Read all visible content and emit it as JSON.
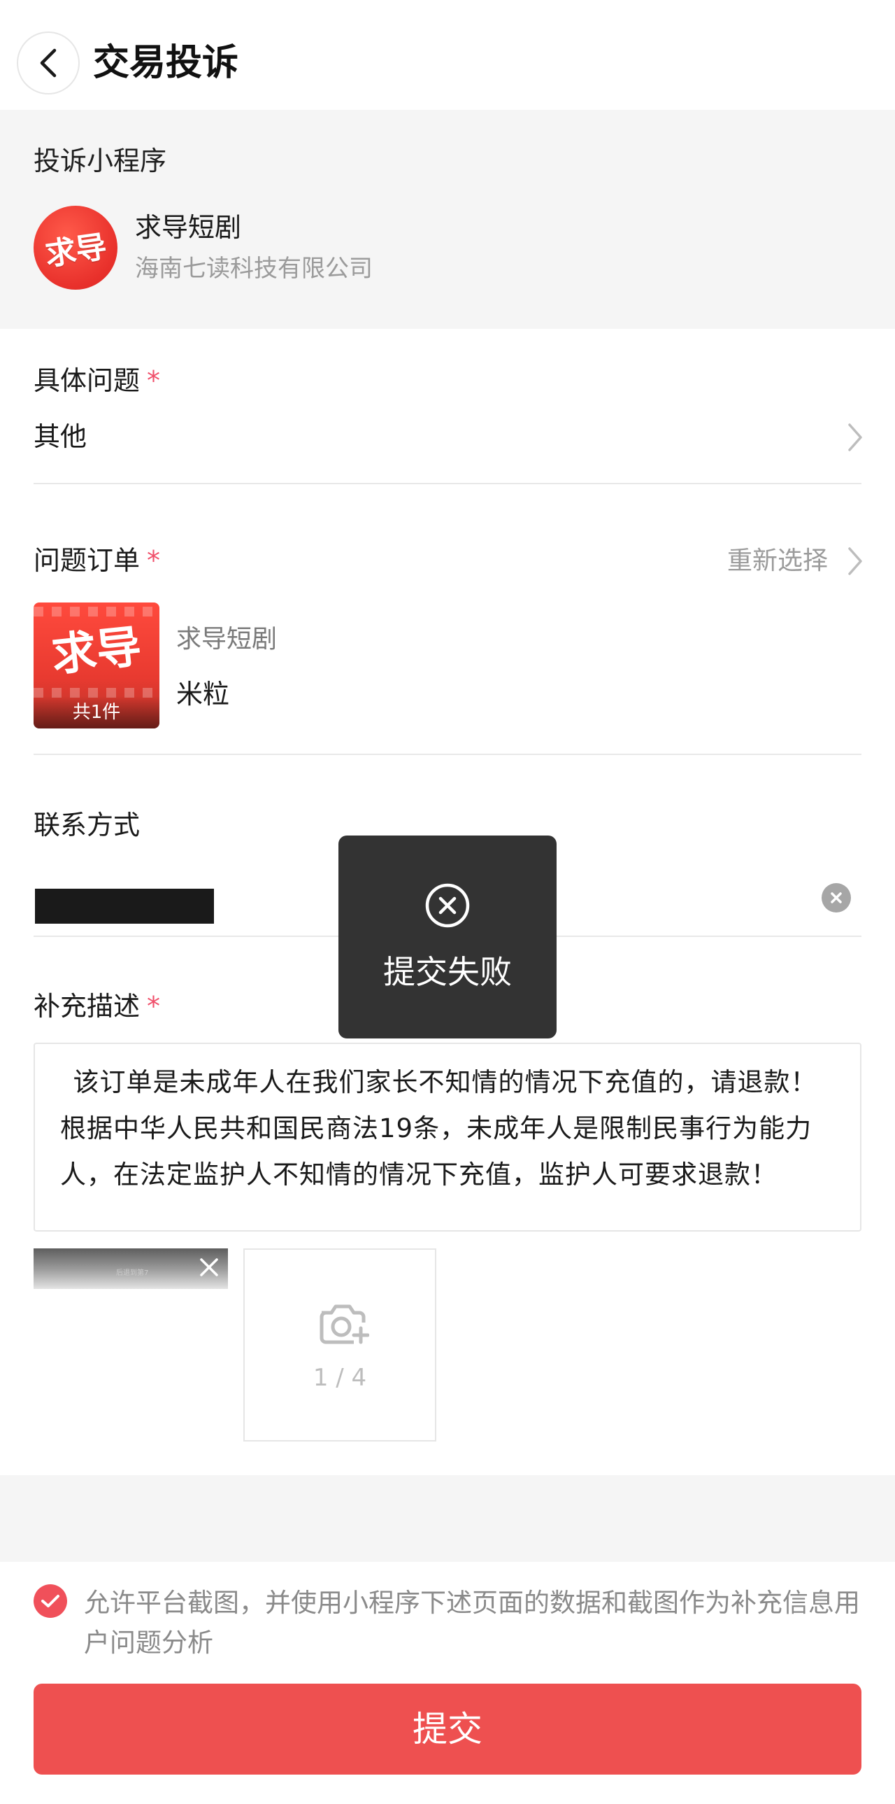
{
  "header": {
    "title": "交易投诉",
    "back_icon": "chevron-left-icon"
  },
  "mini_program": {
    "heading": "投诉小程序",
    "logo_text": "求导",
    "name": "求导短剧",
    "company": "海南七读科技有限公司"
  },
  "issue": {
    "label": "具体问题",
    "required_mark": "*",
    "value": "其他"
  },
  "order": {
    "label": "问题订单",
    "required_mark": "*",
    "reselect_label": "重新选择",
    "thumb_text": "求导",
    "count_label": "共1件",
    "store_name": "求导短剧",
    "item_name": "米粒"
  },
  "contact": {
    "label": "联系方式",
    "value_hidden": true
  },
  "description": {
    "label": "补充描述",
    "required_mark": "*",
    "text": "该订单是未成年人在我们家长不知情的情况下充值的，请退款！根据中华人民共和国民商法19条，未成年人是限制民事行为能力人，在法定监护人不知情的情况下充值，监护人可要求退款！"
  },
  "uploads": {
    "thumb_caption": "后退到第7",
    "count_label": "1 / 4"
  },
  "agreement": {
    "checked": true,
    "text": "允许平台截图，并使用小程序下述页面的数据和截图作为补充信息用户问题分析"
  },
  "submit": {
    "label": "提交"
  },
  "toast": {
    "text": "提交失败",
    "icon": "close-circle-icon"
  },
  "colors": {
    "accent": "#ee5050",
    "required": "#f0506b",
    "muted": "#9b9b9b",
    "toast_bg": "#333333",
    "section_bg": "#f5f5f5"
  }
}
